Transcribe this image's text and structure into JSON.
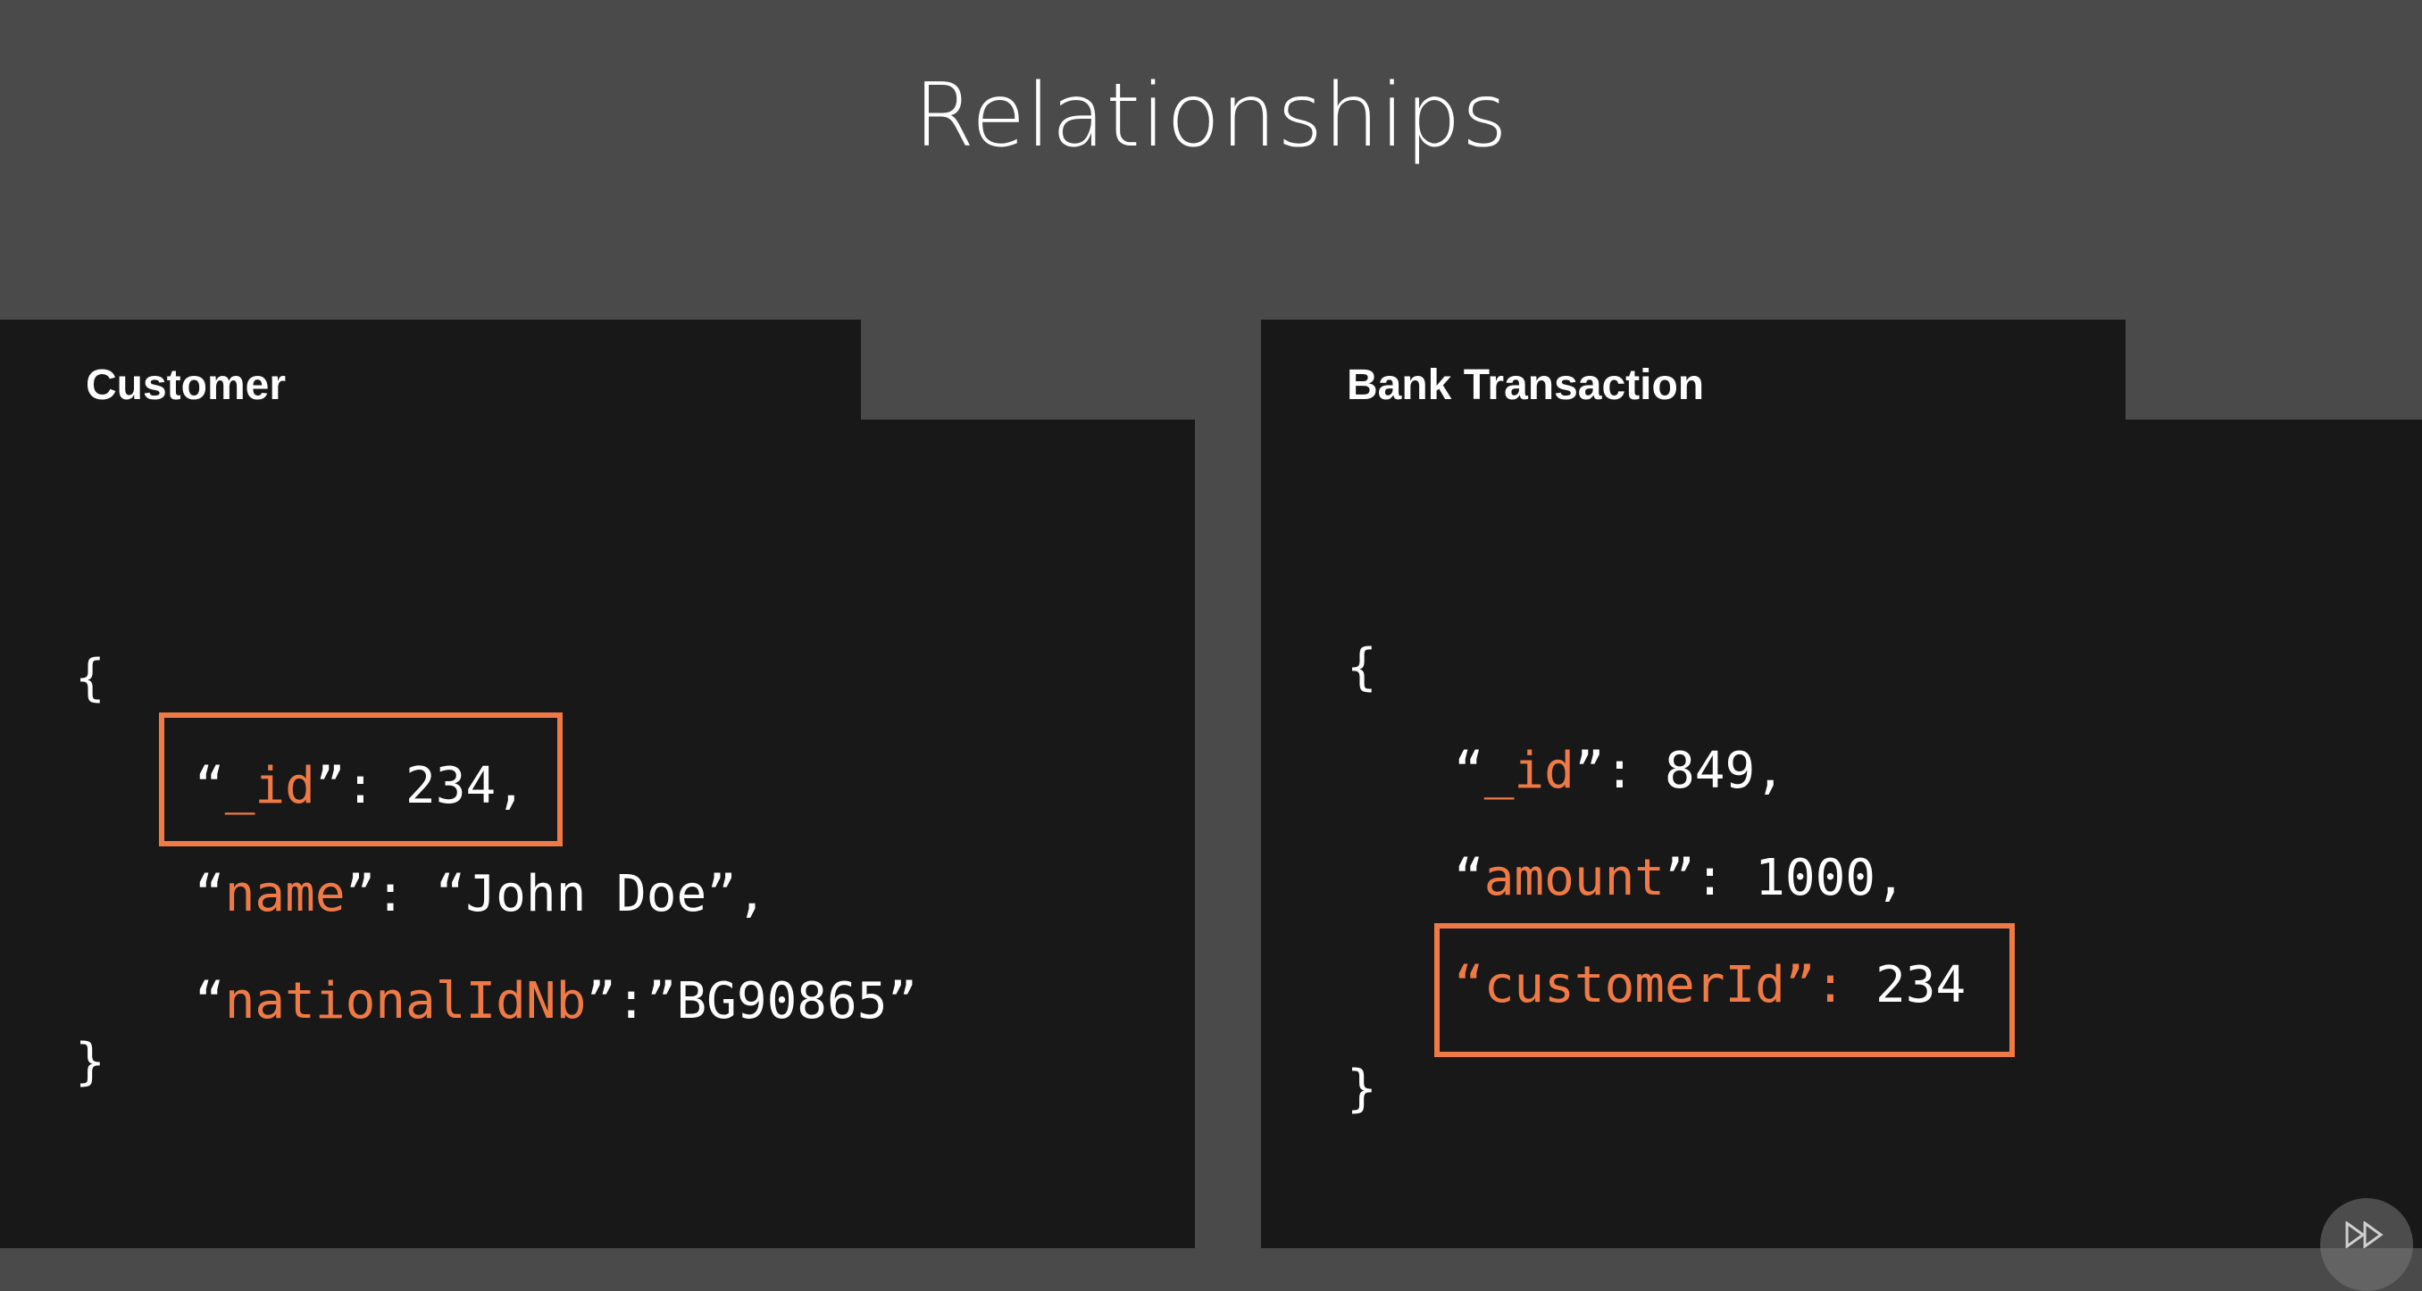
{
  "slide": {
    "title": "Relationships"
  },
  "customer": {
    "heading": "Customer",
    "open_brace": "{",
    "close_brace": "}",
    "lines": [
      {
        "open_quote": "“",
        "key": "_id",
        "close_quote": "”",
        "rest": ": 234,"
      },
      {
        "open_quote": "“",
        "key": "name",
        "close_quote": "”",
        "rest": ": “John Doe”,"
      },
      {
        "open_quote": "“",
        "key": "nationalIdNb",
        "close_quote": "”",
        "rest": ":”BG90865”"
      }
    ]
  },
  "transaction": {
    "heading": "Bank Transaction",
    "open_brace": "{",
    "close_brace": "}",
    "lines": [
      {
        "open_quote": "“",
        "key": "_id",
        "close_quote": "”",
        "rest": ": 849,"
      },
      {
        "open_quote": "“",
        "key": "amount",
        "close_quote": "”",
        "rest": ": 1000,"
      },
      {
        "open_quote": "“",
        "key": "customerId",
        "close_quote": "”: ",
        "rest": "234"
      }
    ]
  },
  "colors": {
    "background": "#4a4a4a",
    "panel": "#181818",
    "accent": "#f07a45",
    "text": "#ffffff"
  },
  "icons": {
    "corner": "play-forward-icon"
  }
}
